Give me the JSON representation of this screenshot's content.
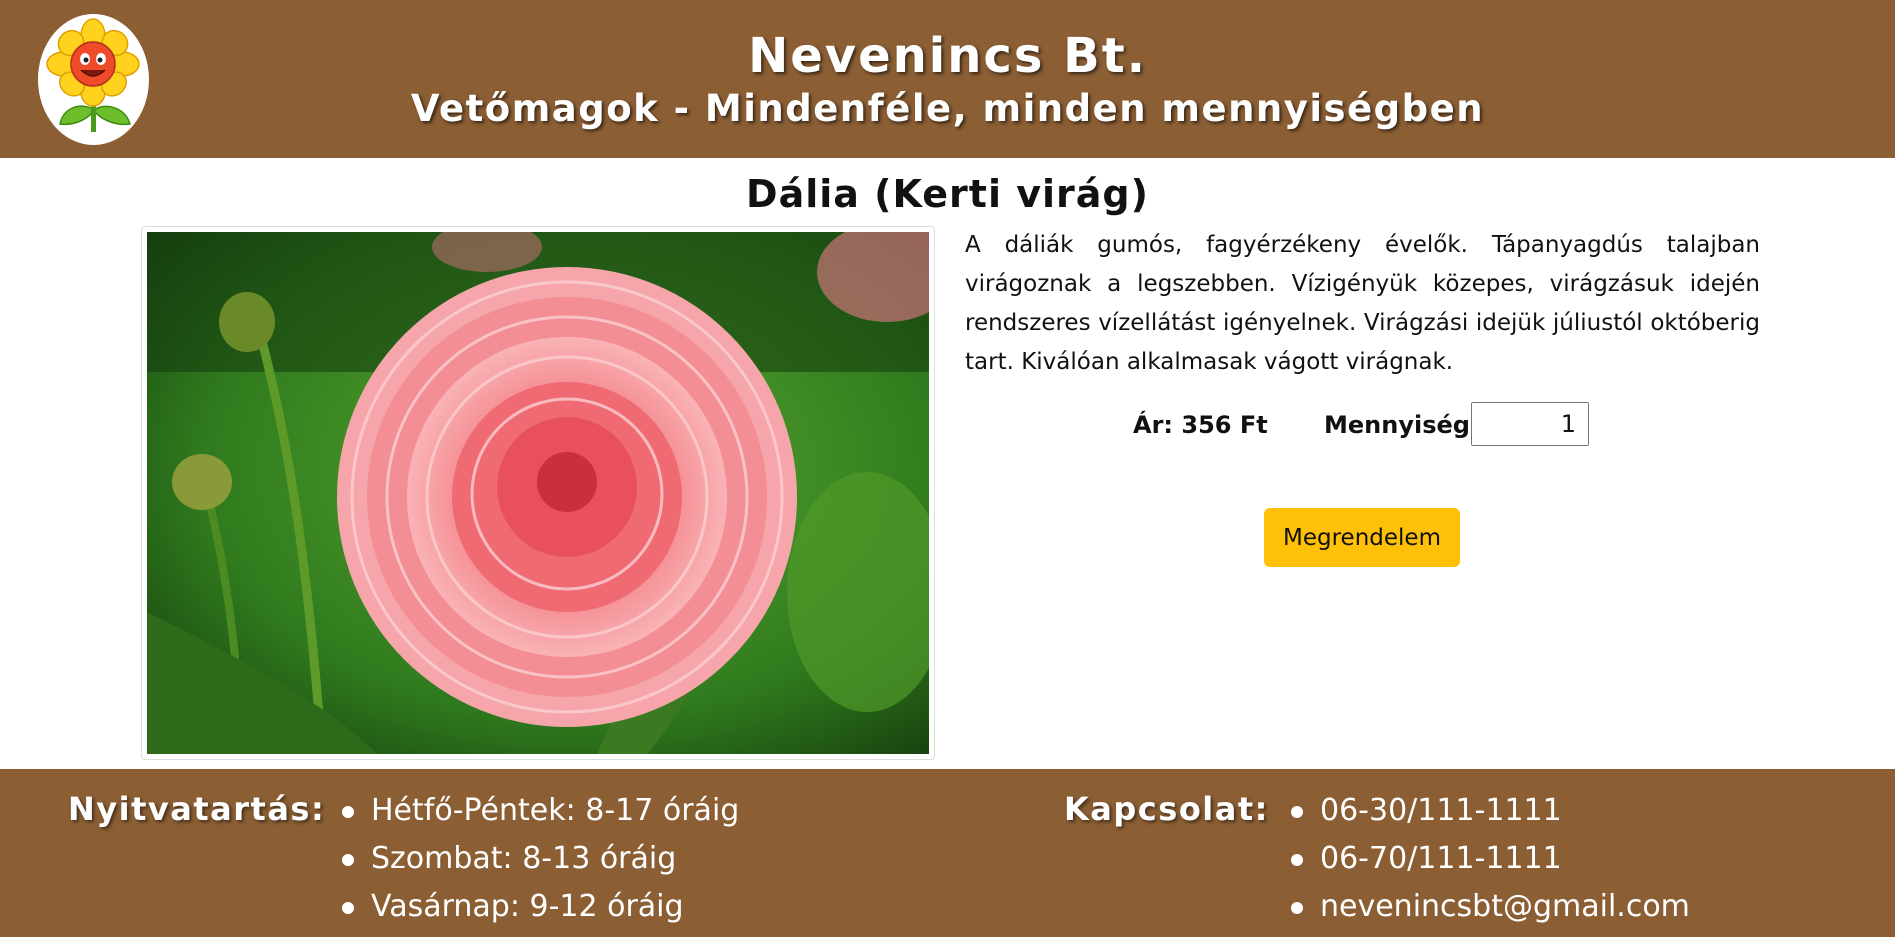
{
  "header": {
    "title": "Nevenincs Bt.",
    "subtitle": "Vetőmagok - Mindenféle, minden mennyiségben",
    "logo_icon": "sunflower-mascot-icon"
  },
  "product": {
    "title": "Dália (Kerti virág)",
    "image_icon": "dahlia-photo",
    "description": "A dáliák gumós, fagyérzékeny évelők. Tápanyagdús talajban virágoznak a legszebben. Vízigényük közepes, virágzásuk idején rendszeres vízellátást igényelnek. Virágzási idejük júliustól októberig tart. Kiválóan alkalmasak vágott virágnak.",
    "price_label": "Ár: 356 Ft",
    "quantity_label": "Mennyiség:",
    "quantity_value": "1",
    "order_button": "Megrendelem"
  },
  "footer": {
    "hours_heading": "Nyitvatartás:",
    "hours": [
      "Hétfő-Péntek: 8-17 óráig",
      "Szombat: 8-13 óráig",
      "Vasárnap: 9-12 óráig"
    ],
    "contact_heading": "Kapcsolat:",
    "contacts": [
      "06-30/111-1111",
      "06-70/111-1111",
      "nevenincsbt@gmail.com"
    ]
  },
  "colors": {
    "brand_brown": "#8b5e34",
    "order_button": "#ffc107"
  }
}
